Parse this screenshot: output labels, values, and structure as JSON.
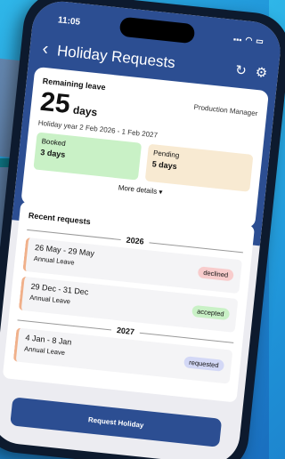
{
  "status": {
    "time": "11:05",
    "signal_icon": "signal-icon",
    "wifi_icon": "wifi-icon",
    "battery_icon": "battery-icon"
  },
  "header": {
    "title": "Holiday Requests",
    "back_icon": "chevron-left-icon",
    "refresh_icon": "refresh-icon",
    "filter_icon": "sliders-icon"
  },
  "summary": {
    "label": "Remaining leave",
    "role": "Production Manager",
    "days": "25",
    "days_unit": "days",
    "holiday_year": "Holiday year 2 Feb 2026 - 1 Feb 2027",
    "booked_label": "Booked",
    "booked_value": "3 days",
    "pending_label": "Pending",
    "pending_value": "5 days",
    "more_details": "More details ▾"
  },
  "recent": {
    "heading": "Recent requests",
    "groups": [
      {
        "year": "2026",
        "items": [
          {
            "dates": "26 May - 29 May",
            "type": "Annual Leave",
            "status": "declined"
          },
          {
            "dates": "29 Dec - 31 Dec",
            "type": "Annual Leave",
            "status": "accepted"
          }
        ]
      },
      {
        "year": "2027",
        "items": [
          {
            "dates": "4 Jan - 8 Jan",
            "type": "Annual Leave",
            "status": "requested"
          }
        ]
      }
    ]
  },
  "actions": {
    "request_button": "Request Holiday"
  },
  "colors": {
    "primary": "#2c4e92",
    "booked_bg": "#c9f1c6",
    "pending_bg": "#f8ead2",
    "declined": "#f8cccc",
    "accepted": "#c9f1c6",
    "requested": "#d3d8f6"
  }
}
